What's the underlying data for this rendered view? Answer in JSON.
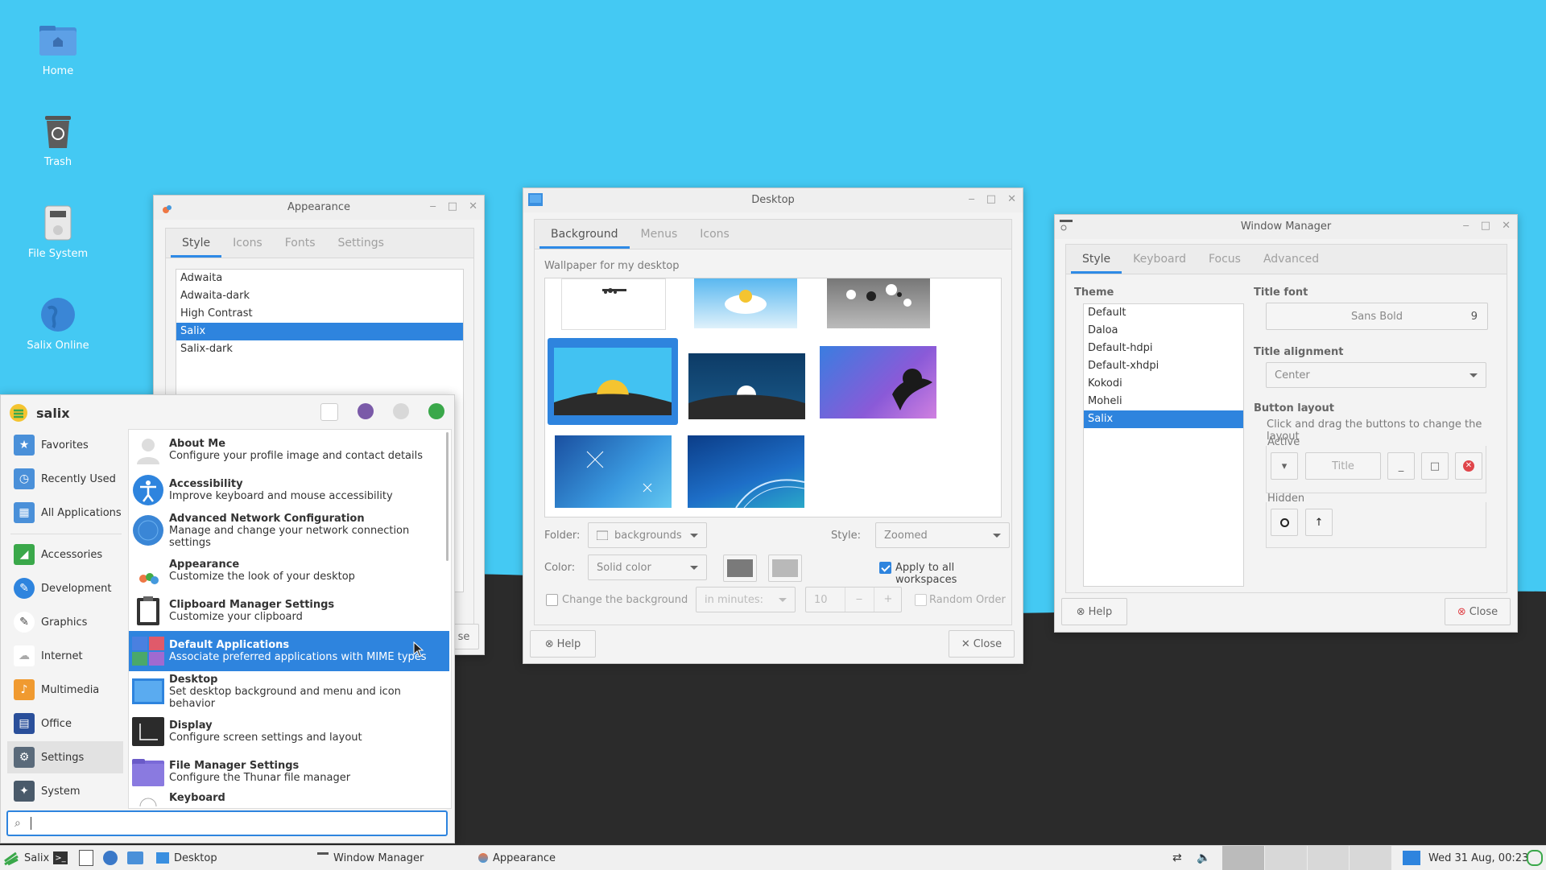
{
  "desktop_icons": [
    {
      "label": "Home",
      "icon": "home-folder-icon"
    },
    {
      "label": "Trash",
      "icon": "trash-icon"
    },
    {
      "label": "File System",
      "icon": "drive-icon"
    },
    {
      "label": "Salix Online",
      "icon": "globe-icon"
    }
  ],
  "appearance": {
    "title": "Appearance",
    "tabs": [
      "Style",
      "Icons",
      "Fonts",
      "Settings"
    ],
    "themes": [
      "Adwaita",
      "Adwaita-dark",
      "High Contrast",
      "Salix",
      "Salix-dark"
    ],
    "selected": "Salix",
    "close_label": "se"
  },
  "desktop_win": {
    "title": "Desktop",
    "tabs": [
      "Background",
      "Menus",
      "Icons"
    ],
    "wallpaper_label": "Wallpaper for my desktop",
    "folder_label": "Folder:",
    "folder_value": "backgrounds",
    "style_label": "Style:",
    "style_value": "Zoomed",
    "color_label": "Color:",
    "color_value": "Solid color",
    "apply_all": "Apply to all workspaces",
    "change_bg": "Change the background",
    "interval_unit": "in minutes:",
    "interval_value": "10",
    "random_order": "Random Order",
    "help": "Help",
    "close": "Close",
    "colors": {
      "color1": "#7a7a7a",
      "color2": "#b9b9b9"
    }
  },
  "wm": {
    "title": "Window Manager",
    "tabs": [
      "Style",
      "Keyboard",
      "Focus",
      "Advanced"
    ],
    "theme_label": "Theme",
    "themes": [
      "Default",
      "Daloa",
      "Default-hdpi",
      "Default-xhdpi",
      "Kokodi",
      "Moheli",
      "Salix"
    ],
    "selected": "Salix",
    "title_font_label": "Title font",
    "title_font": "Sans Bold",
    "title_font_size": "9",
    "title_alignment_label": "Title alignment",
    "title_alignment": "Center",
    "button_layout_label": "Button layout",
    "button_layout_hint": "Click and drag the buttons to change the layout",
    "active_label": "Active",
    "title_button": "Title",
    "hidden_label": "Hidden",
    "help": "Help",
    "close": "Close"
  },
  "menu": {
    "user": "salix",
    "categories": [
      "Favorites",
      "Recently Used",
      "All Applications",
      "Accessories",
      "Development",
      "Graphics",
      "Internet",
      "Multimedia",
      "Office",
      "Settings",
      "System"
    ],
    "selected_category": "Settings",
    "apps": [
      {
        "name": "About Me",
        "desc": "Configure your profile image and contact details"
      },
      {
        "name": "Accessibility",
        "desc": "Improve keyboard and mouse accessibility"
      },
      {
        "name": "Advanced Network Configuration",
        "desc": "Manage and change your network connection settings"
      },
      {
        "name": "Appearance",
        "desc": "Customize the look of your desktop"
      },
      {
        "name": "Clipboard Manager Settings",
        "desc": "Customize your clipboard"
      },
      {
        "name": "Default Applications",
        "desc": "Associate preferred applications with MIME types"
      },
      {
        "name": "Desktop",
        "desc": "Set desktop background and menu and icon behavior"
      },
      {
        "name": "Display",
        "desc": "Configure screen settings and layout"
      },
      {
        "name": "File Manager Settings",
        "desc": "Configure the Thunar file manager"
      },
      {
        "name": "Keyboard",
        "desc": ""
      }
    ],
    "selected_app": "Default Applications",
    "search_value": ""
  },
  "taskbar": {
    "start_label": "Salix",
    "tasks": [
      "Desktop",
      "Window Manager",
      "Appearance"
    ],
    "clock": "Wed 31 Aug, 00:23"
  }
}
